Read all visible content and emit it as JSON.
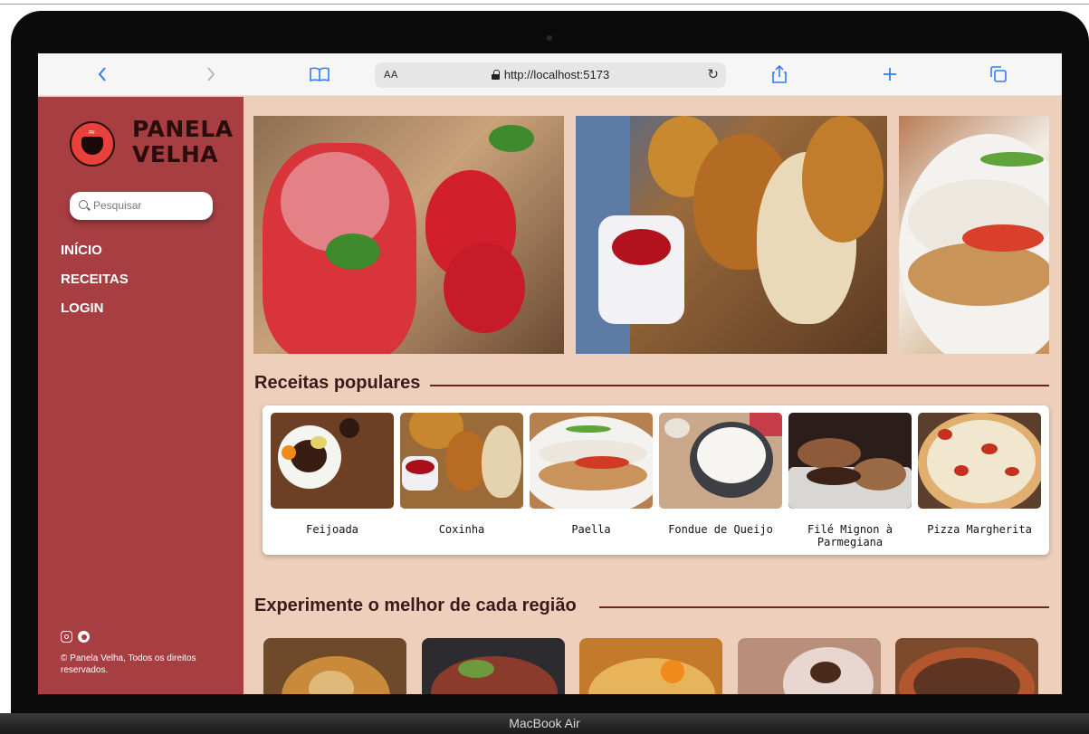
{
  "device": {
    "label": "MacBook Air"
  },
  "browser": {
    "url": "http://localhost:5173",
    "aa_label": "AA",
    "icons": [
      "back-icon",
      "forward-icon",
      "bookmarks-icon",
      "reload-icon",
      "share-icon",
      "new-tab-icon",
      "tabs-icon"
    ]
  },
  "sidebar": {
    "brand_line1": "PANELA",
    "brand_line2": "VELHA",
    "search_placeholder": "Pesquisar",
    "nav": [
      {
        "label": "INÍCIO"
      },
      {
        "label": "RECEITAS"
      },
      {
        "label": "LOGIN"
      }
    ],
    "copyright": "© Panela Velha, Todos os direitos reservados."
  },
  "main": {
    "popular_title": "Receitas populares",
    "popular": [
      {
        "name": "Feijoada"
      },
      {
        "name": "Coxinha"
      },
      {
        "name": "Paella"
      },
      {
        "name": "Fondue de Queijo"
      },
      {
        "name": "Filé Mignon à Parmegiana"
      },
      {
        "name": "Pizza Margherita"
      }
    ],
    "regions_title": "Experimente o melhor de cada região"
  },
  "colors": {
    "sidebar": "#a63e42",
    "background": "#edcfbc",
    "accent_link": "#2f7cf6",
    "heading": "#3a1b1b"
  }
}
